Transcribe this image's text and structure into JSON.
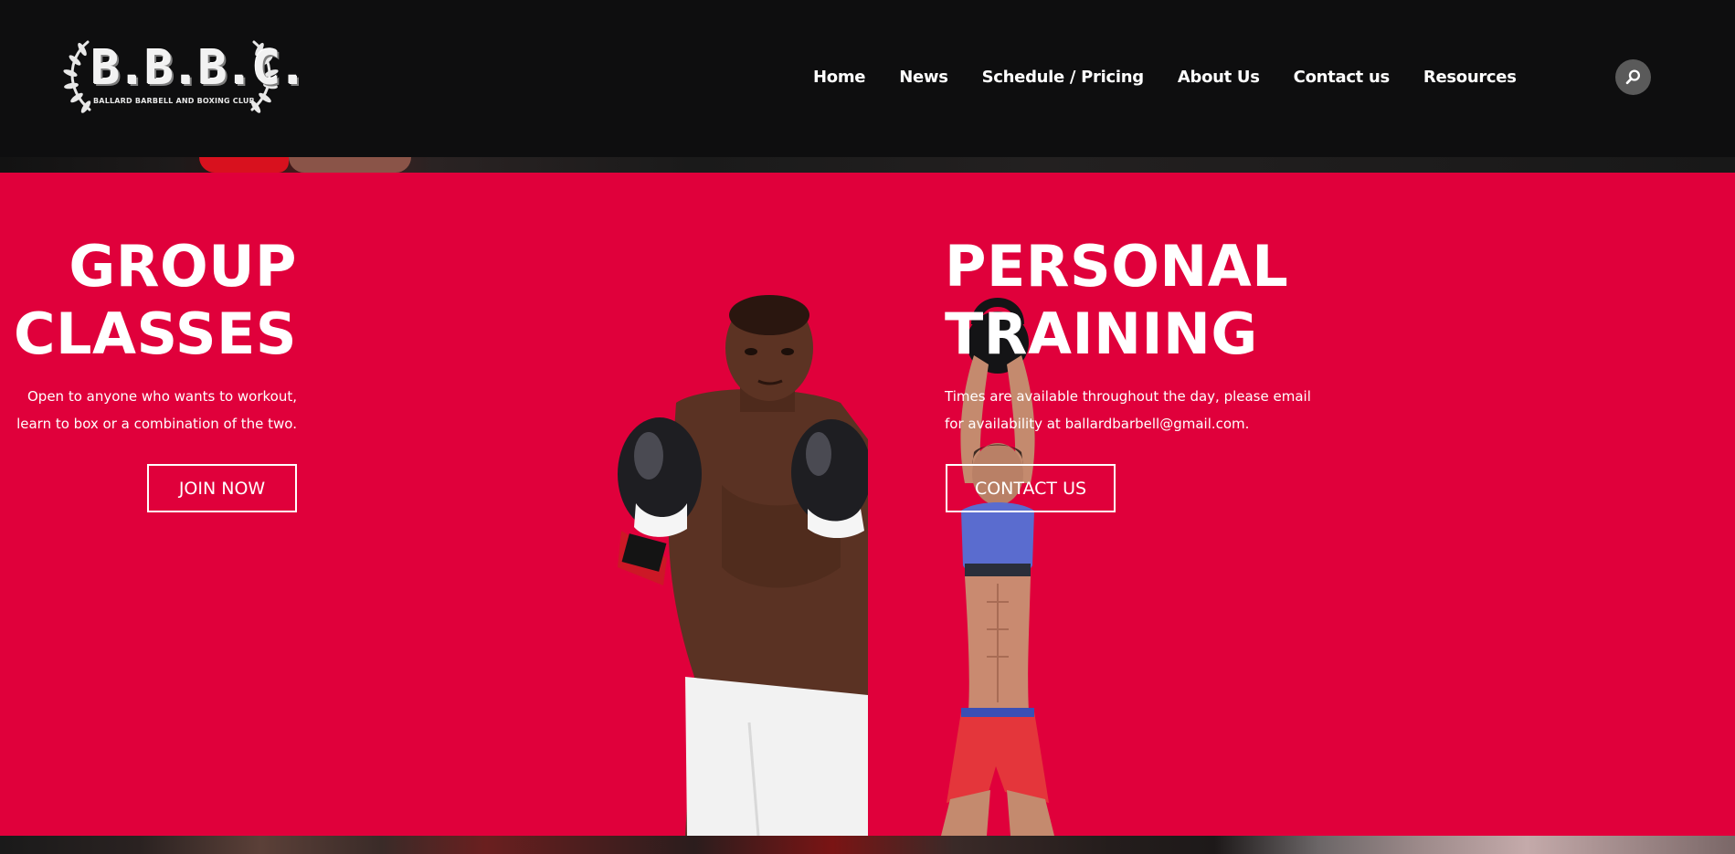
{
  "header": {
    "logo": {
      "text": "B.B.B.C.",
      "subtitle": "BALLARD BARBELL AND BOXING CLUB"
    },
    "nav": [
      {
        "label": "Home"
      },
      {
        "label": "News"
      },
      {
        "label": "Schedule / Pricing"
      },
      {
        "label": "About Us"
      },
      {
        "label": "Contact us"
      },
      {
        "label": "Resources"
      }
    ],
    "search_icon": "search-icon"
  },
  "hero": {
    "background_color": "#e0003b",
    "group": {
      "title_line1": "GROUP",
      "title_line2": "CLASSES",
      "desc_line1": "Open to anyone who wants to workout,",
      "desc_line2": "learn to box or a combination of the two.",
      "button": "JOIN NOW"
    },
    "personal": {
      "title_line1": "PERSONAL",
      "title_line2": "TRAINING",
      "desc_line1": "Times are available throughout the day, please email",
      "desc_line2": "for availability at ballardbarbell@gmail.com.",
      "button": "CONTACT US"
    }
  }
}
